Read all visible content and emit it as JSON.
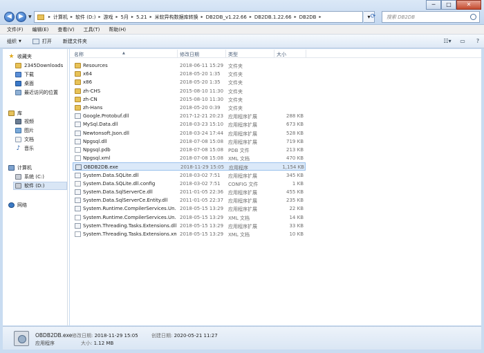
{
  "window": {
    "breadcrumb": [
      "计算机",
      "软件 (D:)",
      "游戏",
      "5月",
      "5.21",
      "米软异构数据库转换",
      "DB2DB_v1.22.66",
      "DB2DB.1.22.66",
      "DB2DB"
    ],
    "search_placeholder": "搜索 DB2DB",
    "buttons": {
      "minimize": "─",
      "maximize": "□",
      "close": "✕"
    }
  },
  "menu": [
    "文件(F)",
    "编辑(E)",
    "查看(V)",
    "工具(T)",
    "帮助(H)"
  ],
  "toolbar": {
    "organize": "组织",
    "open": "打开",
    "new_folder": "新建文件夹"
  },
  "nav": {
    "favorites": "收藏夹",
    "fav_items": [
      "2345Downloads",
      "下载",
      "桌面",
      "最近访问的位置"
    ],
    "libraries": "库",
    "lib_items": [
      "视频",
      "图片",
      "文档",
      "音乐"
    ],
    "computer": "计算机",
    "drives": [
      "系统 (C:)",
      "软件 (D:)"
    ],
    "network": "网络"
  },
  "columns": {
    "name": "名称",
    "date": "修改日期",
    "type": "类型",
    "size": "大小"
  },
  "files": [
    {
      "name": "Resources",
      "date": "2018-06-11 15:29",
      "type": "文件夹",
      "size": "",
      "icon": "folder"
    },
    {
      "name": "x64",
      "date": "2018-05-20 1:35",
      "type": "文件夹",
      "size": "",
      "icon": "folder"
    },
    {
      "name": "x86",
      "date": "2018-05-20 1:35",
      "type": "文件夹",
      "size": "",
      "icon": "folder"
    },
    {
      "name": "zh-CHS",
      "date": "2015-08-10 11:30",
      "type": "文件夹",
      "size": "",
      "icon": "folder"
    },
    {
      "name": "zh-CN",
      "date": "2015-08-10 11:30",
      "type": "文件夹",
      "size": "",
      "icon": "folder"
    },
    {
      "name": "zh-Hans",
      "date": "2018-05-20 0:39",
      "type": "文件夹",
      "size": "",
      "icon": "folder"
    },
    {
      "name": "Google.Protobuf.dll",
      "date": "2017-12-21 20:23",
      "type": "应用程序扩展",
      "size": "288 KB",
      "icon": "dll"
    },
    {
      "name": "MySql.Data.dll",
      "date": "2018-03-23 15:10",
      "type": "应用程序扩展",
      "size": "673 KB",
      "icon": "dll"
    },
    {
      "name": "Newtonsoft.Json.dll",
      "date": "2018-03-24 17:44",
      "type": "应用程序扩展",
      "size": "528 KB",
      "icon": "dll"
    },
    {
      "name": "Npgsql.dll",
      "date": "2018-07-08 15:08",
      "type": "应用程序扩展",
      "size": "719 KB",
      "icon": "dll"
    },
    {
      "name": "Npgsql.pdb",
      "date": "2018-07-08 15:08",
      "type": "PDB 文件",
      "size": "213 KB",
      "icon": "pdb"
    },
    {
      "name": "Npgsql.xml",
      "date": "2018-07-08 15:08",
      "type": "XML 文档",
      "size": "470 KB",
      "icon": "xml"
    },
    {
      "name": "OBDB2DB.exe",
      "date": "2018-11-29 15:05",
      "type": "应用程序",
      "size": "1,154 KB",
      "icon": "exe",
      "selected": true
    },
    {
      "name": "System.Data.SQLite.dll",
      "date": "2018-03-02 7:51",
      "type": "应用程序扩展",
      "size": "345 KB",
      "icon": "dll"
    },
    {
      "name": "System.Data.SQLite.dll.config",
      "date": "2018-03-02 7:51",
      "type": "CONFIG 文件",
      "size": "1 KB",
      "icon": "config"
    },
    {
      "name": "System.Data.SqlServerCe.dll",
      "date": "2011-01-05 22:36",
      "type": "应用程序扩展",
      "size": "455 KB",
      "icon": "dll"
    },
    {
      "name": "System.Data.SqlServerCe.Entity.dll",
      "date": "2011-01-05 22:37",
      "type": "应用程序扩展",
      "size": "235 KB",
      "icon": "dll"
    },
    {
      "name": "System.Runtime.CompilerServices.Un...",
      "date": "2018-05-15 13:29",
      "type": "应用程序扩展",
      "size": "22 KB",
      "icon": "dll"
    },
    {
      "name": "System.Runtime.CompilerServices.Un...",
      "date": "2018-05-15 13:29",
      "type": "XML 文档",
      "size": "14 KB",
      "icon": "xml"
    },
    {
      "name": "System.Threading.Tasks.Extensions.dll",
      "date": "2018-05-15 13:29",
      "type": "应用程序扩展",
      "size": "33 KB",
      "icon": "dll"
    },
    {
      "name": "System.Threading.Tasks.Extensions.xml",
      "date": "2018-05-15 13:29",
      "type": "XML 文档",
      "size": "10 KB",
      "icon": "xml"
    }
  ],
  "details": {
    "name": "OBDB2DB.exe",
    "type": "应用程序",
    "modified_label": "修改日期:",
    "modified": "2018-11-29 15:05",
    "size_label": "大小:",
    "size": "1.12 MB",
    "created_label": "创建日期:",
    "created": "2020-05-21 11:27"
  }
}
